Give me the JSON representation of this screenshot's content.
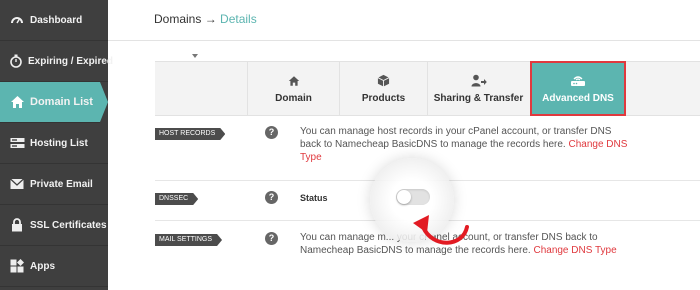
{
  "sidebar": {
    "items": [
      {
        "label": "Dashboard",
        "icon": "speedometer-icon"
      },
      {
        "label": "Expiring / Expired",
        "icon": "timer-icon"
      },
      {
        "label": "Domain List",
        "icon": "home-icon",
        "active": true
      },
      {
        "label": "Hosting List",
        "icon": "server-icon"
      },
      {
        "label": "Private Email",
        "icon": "envelope-icon"
      },
      {
        "label": "SSL Certificates",
        "icon": "lock-icon"
      },
      {
        "label": "Apps",
        "icon": "apps-icon"
      }
    ]
  },
  "breadcrumb": {
    "parent": "Domains",
    "separator": "→",
    "current": "Details"
  },
  "tabs": [
    {
      "label": "Domain",
      "icon": "home-icon"
    },
    {
      "label": "Products",
      "icon": "box-icon"
    },
    {
      "label": "Sharing & Transfer",
      "icon": "user-share-icon"
    },
    {
      "label": "Advanced DNS",
      "icon": "router-icon",
      "active": true
    }
  ],
  "rows": {
    "host_records": {
      "label": "HOST RECORDS",
      "text": "You can manage host records in your cPanel account, or transfer DNS back to Namecheap BasicDNS to manage the records here.",
      "link": "Change DNS Type"
    },
    "dnssec": {
      "label": "DNSSEC",
      "status_label": "Status",
      "toggle_on": false
    },
    "mail_settings": {
      "label": "MAIL SETTINGS",
      "text": "You can manage m... your cPanel account, or transfer DNS back to Namecheap BasicDNS to manage the records here.",
      "text_part1": "You can manage ma",
      "text_part2": "              your cPanel account, or transfer DNS back to Namecheap BasicDNS to manage the records here.",
      "link": "Change DNS Type"
    }
  },
  "help_symbol": "?",
  "colors": {
    "accent": "#5cb5b0",
    "sidebar_bg": "#3f3f3f",
    "highlight": "#e0393e"
  }
}
